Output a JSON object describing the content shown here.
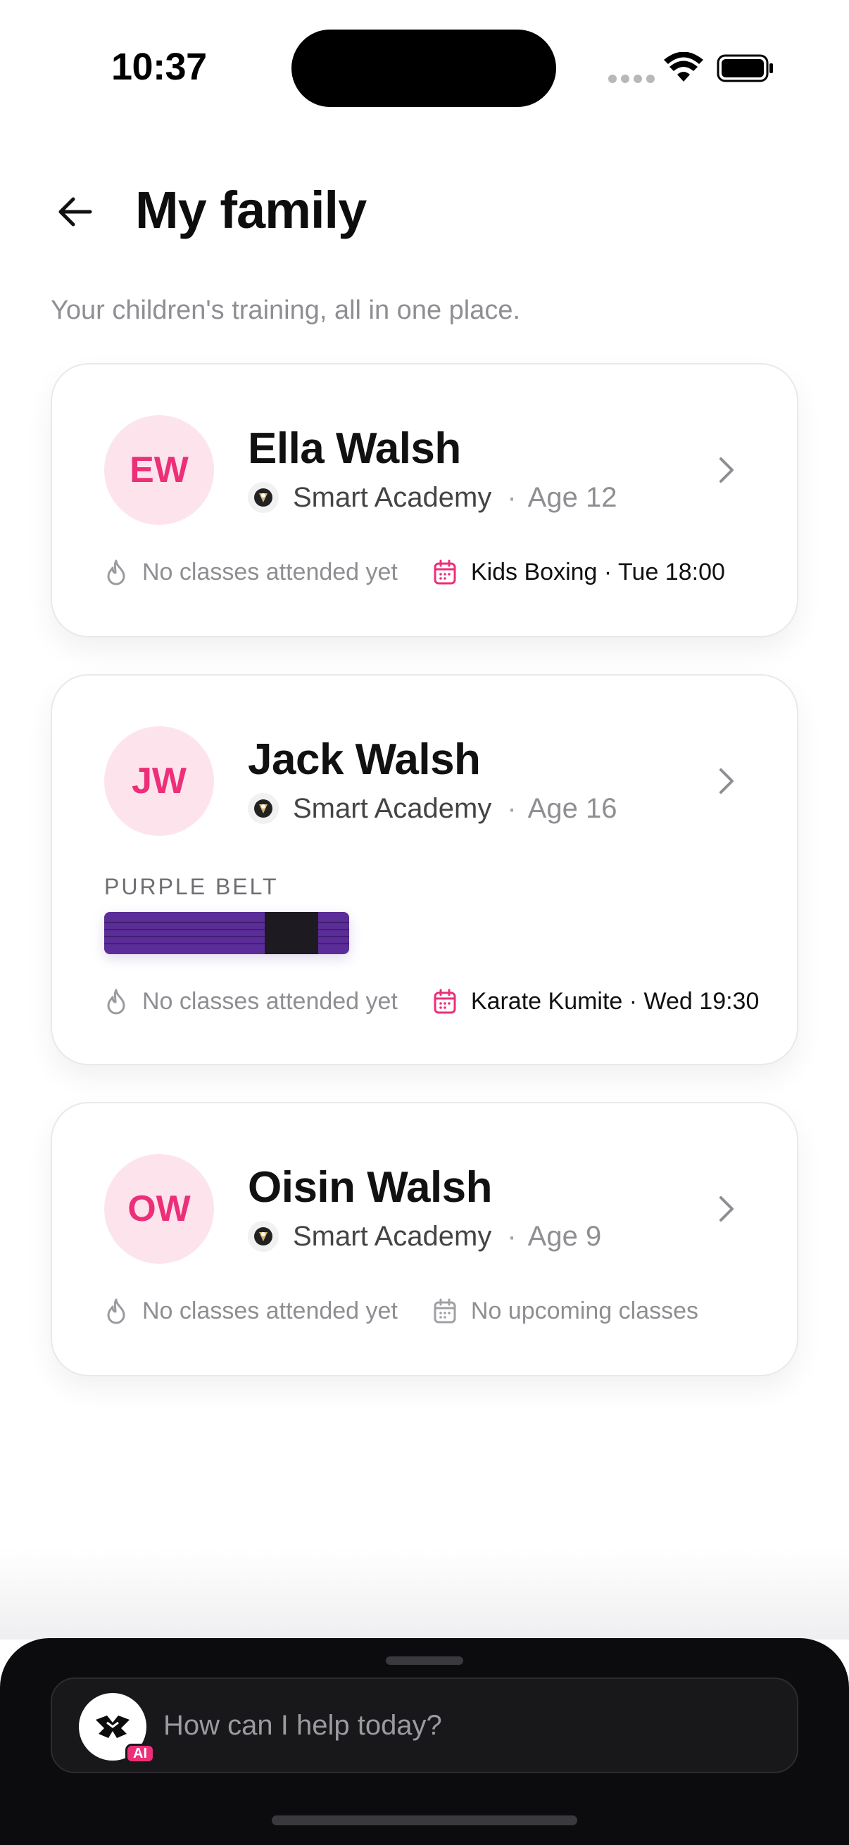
{
  "status_bar": {
    "time": "10:37"
  },
  "header": {
    "title": "My family",
    "subtitle": "Your children's training, all in one place."
  },
  "children": [
    {
      "initials": "EW",
      "name": "Ella Walsh",
      "club": "Smart Academy",
      "age": "Age 12",
      "attendance": "No classes attended yet",
      "next_class": "Kids Boxing · Tue 18:00"
    },
    {
      "initials": "JW",
      "name": "Jack Walsh",
      "club": "Smart Academy",
      "age": "Age 16",
      "belt_label": "PURPLE BELT",
      "belt_color": "#5b2d98",
      "attendance": "No classes attended yet",
      "next_class": "Karate Kumite · Wed 19:30"
    },
    {
      "initials": "OW",
      "name": "Oisin Walsh",
      "club": "Smart Academy",
      "age": "Age 9",
      "attendance": "No classes attended yet",
      "next_class": "No upcoming classes"
    }
  ],
  "separator": "·",
  "assistant": {
    "placeholder": "How can I help today?",
    "badge": "AI"
  },
  "colors": {
    "accent": "#ec2f78",
    "avatar_bg": "#fde4ec",
    "muted_text": "#8e8e93"
  },
  "icons": [
    "back-arrow-icon",
    "chevron-right-icon",
    "flame-icon",
    "calendar-icon",
    "club-logo-icon",
    "wifi-icon",
    "battery-icon"
  ]
}
